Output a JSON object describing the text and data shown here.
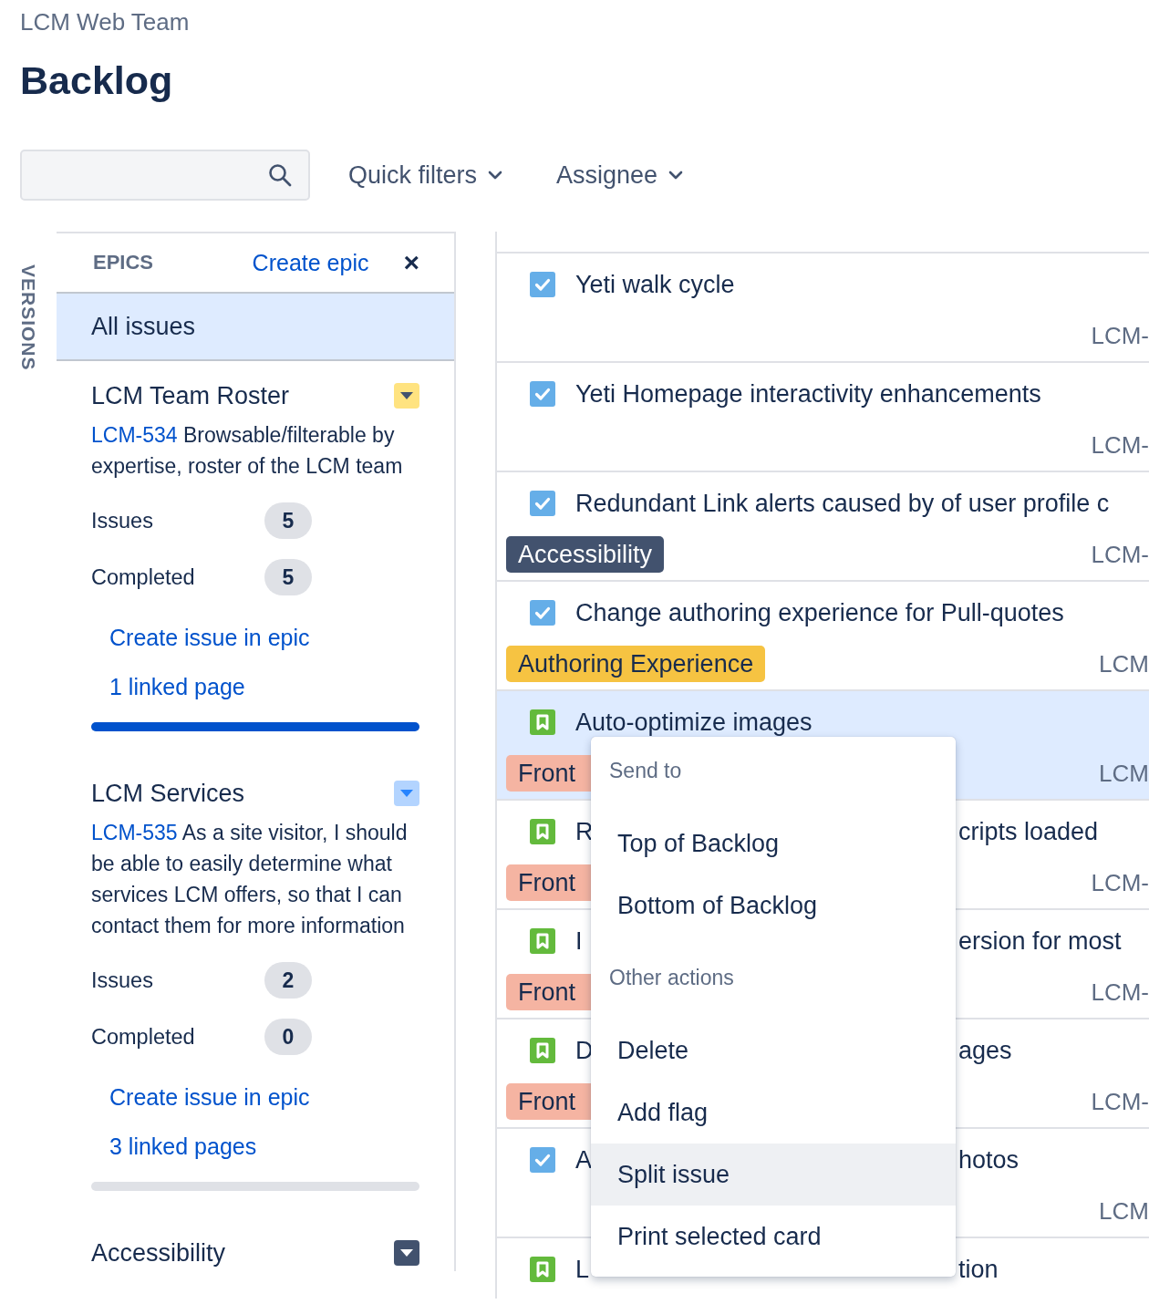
{
  "header": {
    "project": "LCM Web Team",
    "title": "Backlog"
  },
  "filters": [
    {
      "label": "Quick filters"
    },
    {
      "label": "Assignee"
    }
  ],
  "sidebar": {
    "versions_tab": "VERSIONS",
    "epics_heading": "EPICS",
    "create_epic": "Create epic",
    "close": "×",
    "all_issues": {
      "label": "All issues",
      "selected": true
    },
    "epics": [
      {
        "name": "LCM Team Roster",
        "color": "#ffe380",
        "key": "LCM-534",
        "summary": "Browsable/filterable by expertise, roster of the LCM team",
        "issues_label": "Issues",
        "issues": "5",
        "completed_label": "Completed",
        "completed": "5",
        "create_issue": "Create issue in epic",
        "linked_pages": "1 linked page",
        "level": 1
      },
      {
        "name": "LCM Services",
        "color": "#b3d4ff",
        "key": "LCM-535",
        "summary": "As a site visitor, I should be able to easily determine what services LCM offers, so that I can contact them for more information",
        "issues_label": "Issues",
        "issues": "2",
        "completed_label": "Completed",
        "completed": "0",
        "create_issue": "Create issue in epic",
        "linked_pages": "3 linked pages",
        "level": 0
      },
      {
        "name": "Accessibility",
        "color": "#42526e"
      }
    ]
  },
  "issues": [
    {
      "kind": "task",
      "title": "Yeti walk cycle",
      "key": "LCM-",
      "selected": false
    },
    {
      "kind": "task",
      "title": "Yeti Homepage interactivity enhancements",
      "key": "LCM-",
      "selected": false
    },
    {
      "kind": "task",
      "title": "Redundant Link alerts caused by of user profile c",
      "epic": {
        "label": "Accessibility",
        "color": "#42526e"
      },
      "key": "LCM-",
      "selected": false
    },
    {
      "kind": "task",
      "title": "Change authoring experience for Pull-quotes",
      "epic": {
        "label": "Authoring Experience",
        "color": "#f6c342"
      },
      "key": "LCM",
      "selected": false
    },
    {
      "kind": "story",
      "title": "Auto-optimize images",
      "epic": {
        "label": "Front",
        "color": "#f5b4a2"
      },
      "key": "LCM",
      "selected": true
    },
    {
      "kind": "story",
      "title_start": "R",
      "title_end": "cripts loaded",
      "epic": {
        "label": "Front",
        "color": "#f5b4a2"
      },
      "key": "LCM-",
      "selected": false
    },
    {
      "kind": "story",
      "title_start": "I",
      "title_end": "ersion for most",
      "epic": {
        "label": "Front",
        "color": "#f5b4a2"
      },
      "key": "LCM-",
      "selected": false
    },
    {
      "kind": "story",
      "title_start": "D",
      "title_end": "ages",
      "epic": {
        "label": "Front",
        "color": "#f5b4a2"
      },
      "key": "LCM-",
      "selected": false
    },
    {
      "kind": "task",
      "title_start": "A",
      "title_end": "hotos",
      "key": "LCM",
      "selected": false
    },
    {
      "kind": "story",
      "title_start": "L",
      "title_end": "tion",
      "selected": false
    }
  ],
  "context_menu": {
    "sections": [
      {
        "heading": "Send to",
        "items": [
          {
            "label": "Top of Backlog",
            "selected": false
          },
          {
            "label": "Bottom of Backlog",
            "selected": false
          }
        ]
      },
      {
        "heading": "Other actions",
        "items": [
          {
            "label": "Delete",
            "selected": false
          },
          {
            "label": "Add flag",
            "selected": false
          },
          {
            "label": "Split issue",
            "selected": true
          },
          {
            "label": "Print selected card",
            "selected": false
          }
        ]
      }
    ]
  }
}
